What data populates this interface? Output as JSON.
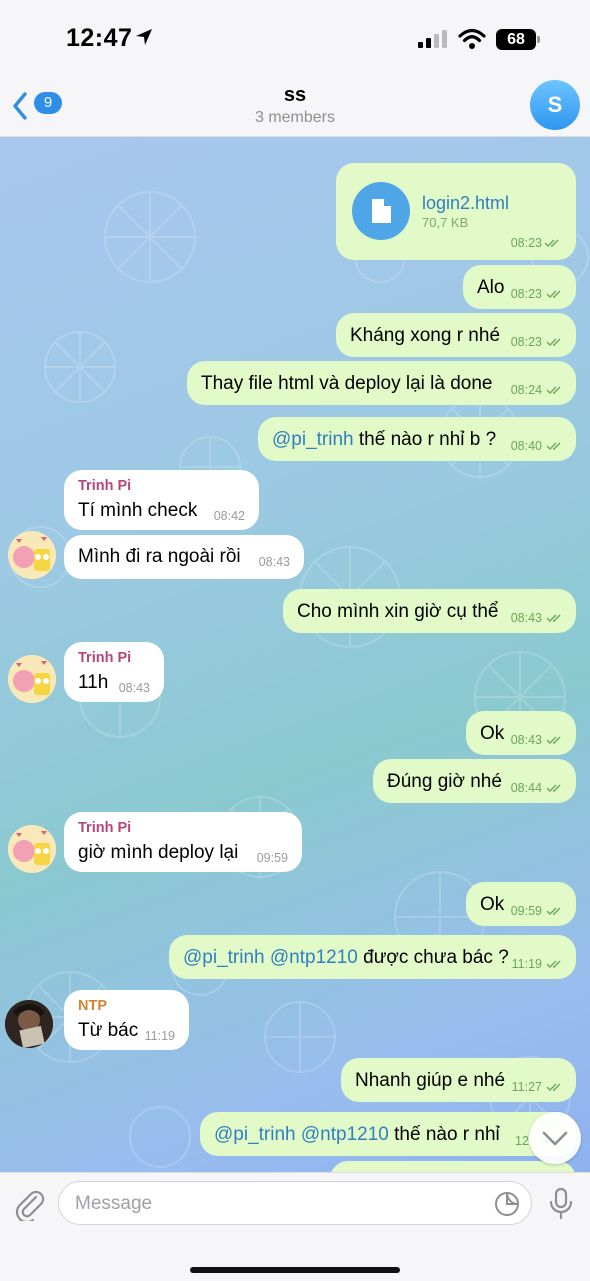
{
  "status_bar": {
    "time": "12:47",
    "battery": "68"
  },
  "header": {
    "back_count": "9",
    "title": "ss",
    "subtitle": "3 members",
    "avatar_letter": "S"
  },
  "messages": [
    {
      "type": "file",
      "direction": "out",
      "file_name": "login2.html",
      "file_size": "70,7 KB",
      "time": "08:23"
    },
    {
      "direction": "out",
      "text": "Alo",
      "time": "08:23"
    },
    {
      "direction": "out",
      "text": "Kháng xong r nhé",
      "time": "08:23"
    },
    {
      "direction": "out",
      "text": "Thay file html và deploy lại là done",
      "time": "08:24"
    },
    {
      "direction": "out",
      "mention": "@pi_trinh",
      "text": " thế nào r nhỉ b ?",
      "time": "08:40"
    },
    {
      "direction": "in",
      "sender": "Trinh Pi",
      "text": "Tí mình check",
      "time": "08:42"
    },
    {
      "direction": "in",
      "text": "Mình đi ra ngoài rồi",
      "time": "08:43"
    },
    {
      "direction": "out",
      "text": "Cho mình xin giờ cụ thể",
      "time": "08:43"
    },
    {
      "direction": "in",
      "sender": "Trinh Pi",
      "text": "11h",
      "time": "08:43"
    },
    {
      "direction": "out",
      "text": "Ok",
      "time": "08:43"
    },
    {
      "direction": "out",
      "text": "Đúng giờ nhé",
      "time": "08:44"
    },
    {
      "direction": "in",
      "sender": "Trinh Pi",
      "text": "giờ mình deploy lại",
      "time": "09:59"
    },
    {
      "direction": "out",
      "text": "Ok",
      "time": "09:59"
    },
    {
      "direction": "out",
      "mention": "@pi_trinh @ntp1210",
      "text": " được chưa bác ?",
      "time": "11:19"
    },
    {
      "direction": "in",
      "sender": "NTP",
      "text": "Từ bác",
      "time": "11:19"
    },
    {
      "direction": "out",
      "text": "Nhanh giúp e nhé",
      "time": "11:27"
    },
    {
      "direction": "out",
      "mention": "@pi_trinh @ntp1210",
      "text": " thế nào r nhỉ",
      "time": "12:"
    }
  ],
  "input": {
    "placeholder": "Message"
  },
  "colors": {
    "accent": "#2f8ee8",
    "outgoing_bubble": "#e2fac7",
    "incoming_bubble": "#ffffff",
    "sender_trinh": "#b3467b",
    "sender_ntp": "#d4842e"
  },
  "icons": [
    "location-arrow-icon",
    "signal-icon",
    "wifi-icon",
    "chevron-left-icon",
    "file-icon",
    "double-check-icon",
    "paperclip-icon",
    "sticker-icon",
    "microphone-icon",
    "chevron-down-icon"
  ]
}
